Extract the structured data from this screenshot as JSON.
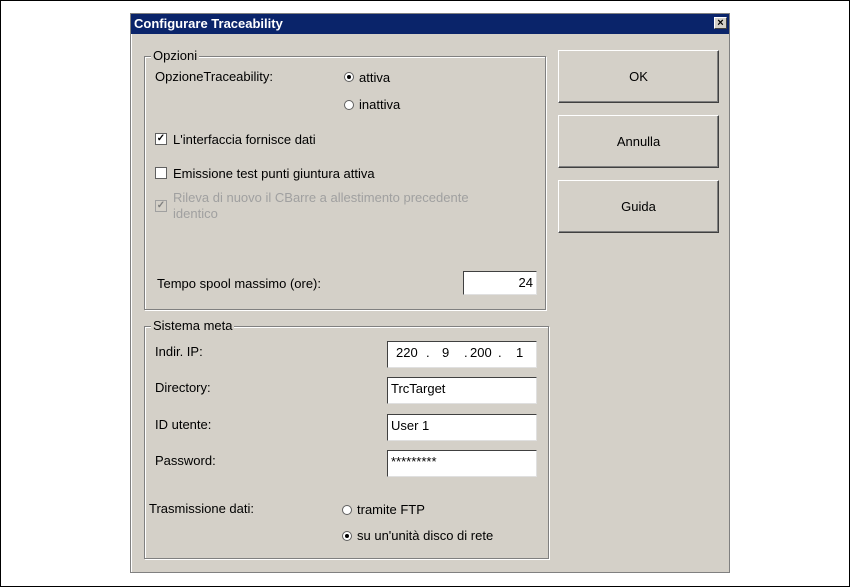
{
  "window": {
    "title": "Configurare Traceability",
    "close_label": "×"
  },
  "options_group": {
    "legend": "Opzioni",
    "option_label": "OpzioneTraceability:",
    "radio_active": "attiva",
    "radio_inactive": "inattiva",
    "selected": "attiva",
    "check_interface": "L'interfaccia fornisce dati",
    "check_interface_checked": true,
    "check_emission": "Emissione test punti giuntura attiva",
    "check_emission_checked": false,
    "check_rescan": "Rileva di nuovo il CBarre a allestimento precedente identico",
    "check_rescan_checked": true,
    "spool_label": "Tempo spool massimo (ore):",
    "spool_value": "24"
  },
  "target_group": {
    "legend": "Sistema meta",
    "ip_label": "Indir. IP:",
    "ip": [
      "220",
      "9",
      "200",
      "1"
    ],
    "directory_label": "Directory:",
    "directory_value": "TrcTarget",
    "user_label": "ID utente:",
    "user_value": "User 1",
    "password_label": "Password:",
    "password_value": "*********",
    "transmission_label": "Trasmissione dati:",
    "radio_ftp": "tramite FTP",
    "radio_network": "su un'unità disco di rete",
    "selected": "su un'unità disco di rete"
  },
  "buttons": {
    "ok": "OK",
    "cancel": "Annulla",
    "help": "Guida"
  }
}
